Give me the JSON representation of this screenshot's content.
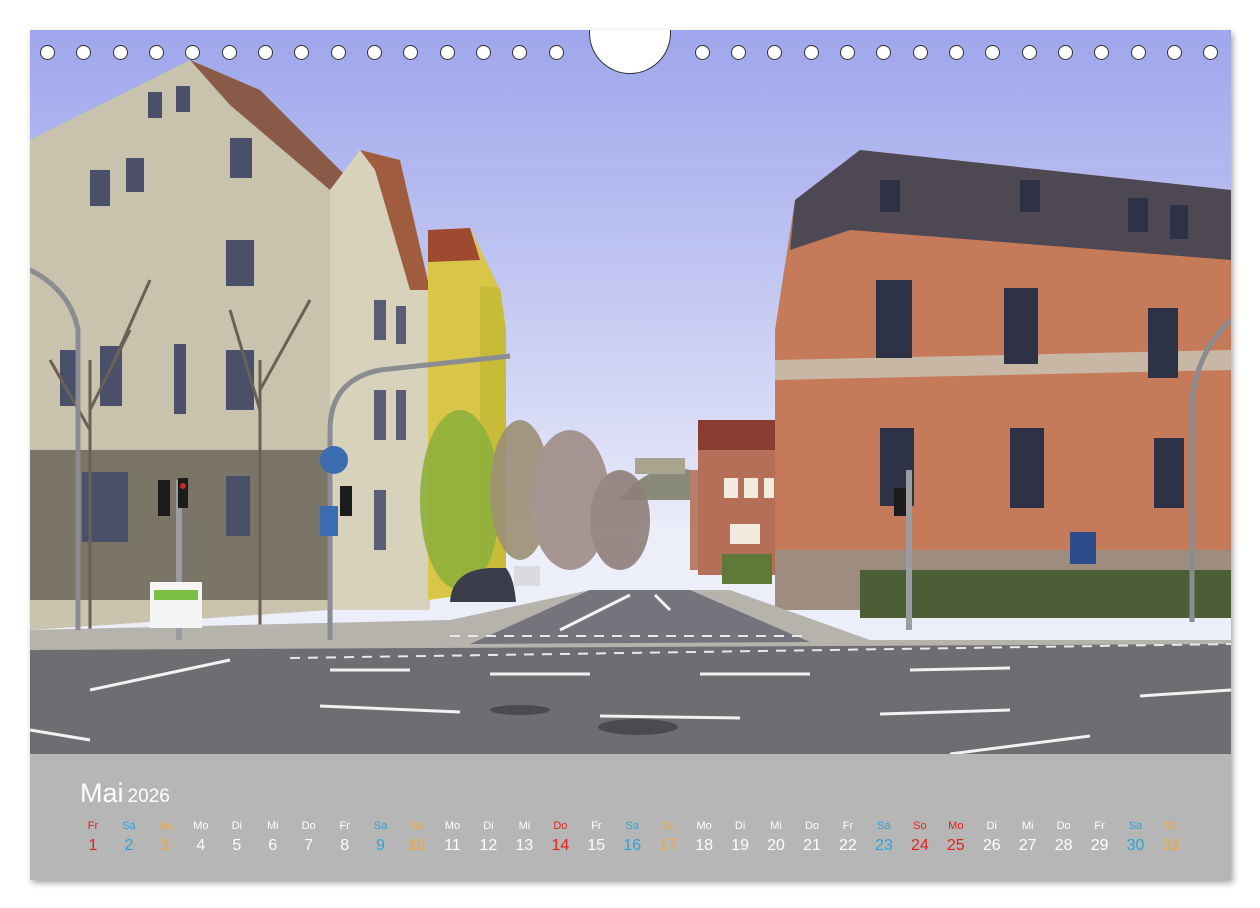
{
  "calendar": {
    "month": "Mai",
    "year": "2026",
    "days": [
      {
        "wd": "Fr",
        "n": "1",
        "type": "red"
      },
      {
        "wd": "Sa",
        "n": "2",
        "type": "sat"
      },
      {
        "wd": "So",
        "n": "3",
        "type": "sun"
      },
      {
        "wd": "Mo",
        "n": "4",
        "type": "normal"
      },
      {
        "wd": "Di",
        "n": "5",
        "type": "normal"
      },
      {
        "wd": "Mi",
        "n": "6",
        "type": "normal"
      },
      {
        "wd": "Do",
        "n": "7",
        "type": "normal"
      },
      {
        "wd": "Fr",
        "n": "8",
        "type": "normal"
      },
      {
        "wd": "Sa",
        "n": "9",
        "type": "sat"
      },
      {
        "wd": "So",
        "n": "10",
        "type": "sun"
      },
      {
        "wd": "Mo",
        "n": "11",
        "type": "normal"
      },
      {
        "wd": "Di",
        "n": "12",
        "type": "normal"
      },
      {
        "wd": "Mi",
        "n": "13",
        "type": "normal"
      },
      {
        "wd": "Do",
        "n": "14",
        "type": "red"
      },
      {
        "wd": "Fr",
        "n": "15",
        "type": "normal"
      },
      {
        "wd": "Sa",
        "n": "16",
        "type": "sat"
      },
      {
        "wd": "So",
        "n": "17",
        "type": "sun"
      },
      {
        "wd": "Mo",
        "n": "18",
        "type": "normal"
      },
      {
        "wd": "Di",
        "n": "19",
        "type": "normal"
      },
      {
        "wd": "Mi",
        "n": "20",
        "type": "normal"
      },
      {
        "wd": "Do",
        "n": "21",
        "type": "normal"
      },
      {
        "wd": "Fr",
        "n": "22",
        "type": "normal"
      },
      {
        "wd": "Sa",
        "n": "23",
        "type": "sat"
      },
      {
        "wd": "So",
        "n": "24",
        "type": "red"
      },
      {
        "wd": "Mo",
        "n": "25",
        "type": "red"
      },
      {
        "wd": "Di",
        "n": "26",
        "type": "normal"
      },
      {
        "wd": "Mi",
        "n": "27",
        "type": "normal"
      },
      {
        "wd": "Do",
        "n": "28",
        "type": "normal"
      },
      {
        "wd": "Fr",
        "n": "29",
        "type": "normal"
      },
      {
        "wd": "Sa",
        "n": "30",
        "type": "sat"
      },
      {
        "wd": "So",
        "n": "31",
        "type": "sun"
      }
    ]
  },
  "colors": {
    "weekday": "#ffffff",
    "saturday": "#2aa4d8",
    "sunday": "#f2a43a",
    "holiday": "#e3231b",
    "calendar_bg": "#b6b6b6"
  },
  "photo": {
    "subject": "street-intersection-photo"
  }
}
